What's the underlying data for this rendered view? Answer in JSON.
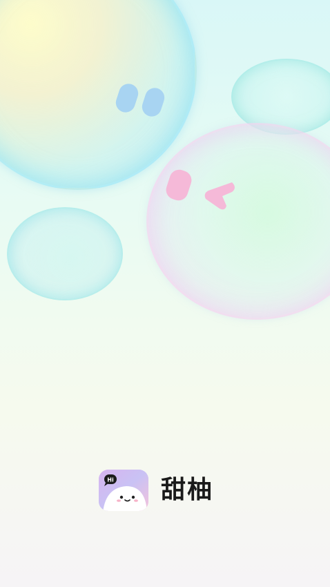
{
  "app": {
    "name": "甜柚",
    "icon_badge": "Hi"
  },
  "colors": {
    "background_top": "#d9f7f7",
    "background_bottom": "#f6f4f6",
    "blue_eye": "#a8d4f2",
    "pink_eye": "#f5b9d8",
    "icon_gradient_start": "#d8b8f0",
    "icon_gradient_end": "#f2c0dc"
  },
  "icons": {
    "app_icon": "smiling-face-icon"
  }
}
